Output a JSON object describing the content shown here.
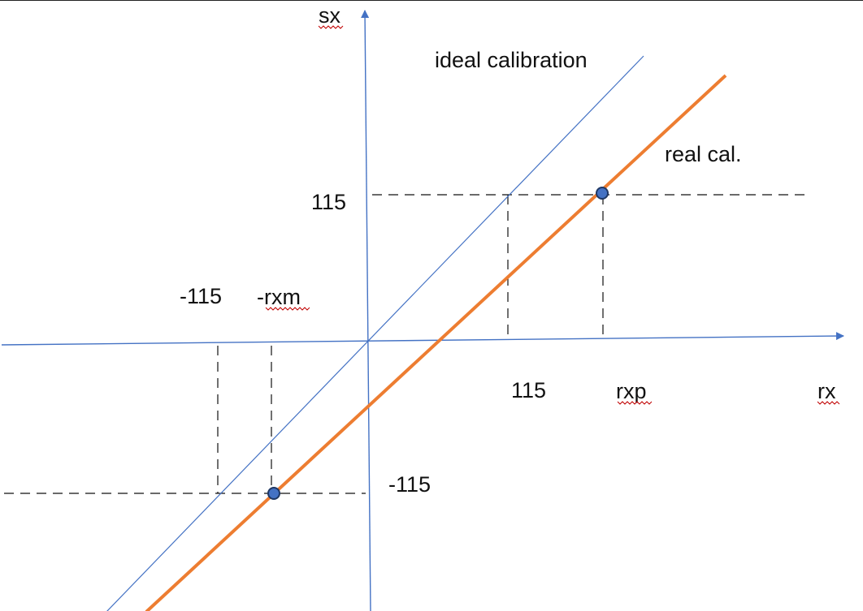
{
  "labels": {
    "y_axis": "sx",
    "x_axis": "rx",
    "ideal_line": "ideal calibration",
    "real_line": "real cal.",
    "y_pos": "115",
    "y_neg": "-115",
    "x_pos": "115",
    "x_neg": "-115",
    "rxp": "rxp",
    "rxm": "-rxm"
  },
  "colors": {
    "axis": "#4472c4",
    "ideal": "#4472c4",
    "real": "#ed7d31",
    "points": "#4472c4"
  }
}
